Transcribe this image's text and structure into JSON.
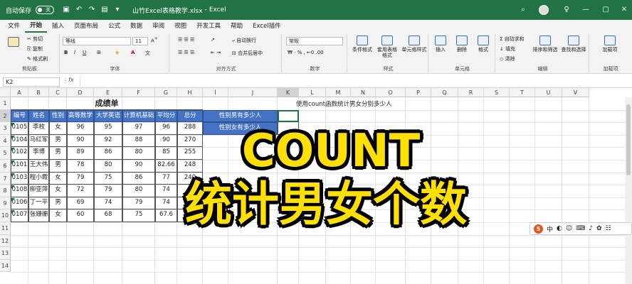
{
  "titlebar": {
    "autosave_label": "自动保存",
    "autosave_state": "关",
    "filename": "山竹Excel表格教学.xlsx",
    "app": "Excel"
  },
  "menu": [
    "文件",
    "开始",
    "插入",
    "页面布局",
    "公式",
    "数据",
    "审阅",
    "视图",
    "开发工具",
    "帮助",
    "Excel插件"
  ],
  "menu_right": {
    "comment": "批注",
    "share": "共享"
  },
  "ribbon": {
    "clipboard": {
      "cut": "剪切",
      "copy": "复制",
      "format_painter": "格式刷",
      "label": "剪贴板"
    },
    "font": {
      "family": "等线",
      "size": "11",
      "label": "字体",
      "bold": "B",
      "italic": "I",
      "underline": "U"
    },
    "alignment": {
      "wrap": "自动换行",
      "merge": "合并后居中",
      "label": "对齐方式"
    },
    "number": {
      "format": "常规",
      "label": "数字"
    },
    "styles": {
      "conditional": "条件格式",
      "table": "套用表格格式",
      "cell": "单元格样式",
      "label": "样式"
    },
    "cells": {
      "insert": "插入",
      "delete": "删除",
      "format": "格式",
      "label": "单元格"
    },
    "editing": {
      "autosum": "自动求和",
      "fill": "填充",
      "clear": "清除",
      "sort": "排序和筛选",
      "find": "查找和选择",
      "label": "编辑"
    },
    "addins": {
      "add": "加载项",
      "label": "加载项"
    }
  },
  "formula": {
    "namebox": "K2",
    "fx": "fx"
  },
  "columns": [
    "A",
    "B",
    "C",
    "D",
    "E",
    "F",
    "G",
    "H",
    "I",
    "J",
    "K",
    "L",
    "M",
    "N",
    "O",
    "P",
    "Q",
    "R",
    "S",
    "T",
    "U",
    "V"
  ],
  "rows": [
    "1",
    "2",
    "3",
    "4",
    "5",
    "6",
    "7",
    "8",
    "9",
    "10",
    "11",
    "12",
    "13",
    "14"
  ],
  "table": {
    "title": "成绩单",
    "headers": [
      "编号",
      "姓名",
      "性别",
      "高等数学",
      "大学英语",
      "计算机基础",
      "平均分",
      "总分"
    ],
    "rows": [
      [
        "0105",
        "李枚",
        "女",
        "96",
        "95",
        "97",
        "96",
        "288"
      ],
      [
        "0104",
        "马红军",
        "男",
        "90",
        "92",
        "88",
        "90",
        "270"
      ],
      [
        "0102",
        "李博",
        "男",
        "89",
        "86",
        "80",
        "85",
        "255"
      ],
      [
        "0101",
        "王大伟",
        "男",
        "78",
        "80",
        "90",
        "82.66",
        "248"
      ],
      [
        "0103",
        "程小霞",
        "女",
        "79",
        "75",
        "86",
        "77",
        "240"
      ],
      [
        "0108",
        "柳亚萍",
        "女",
        "72",
        "79",
        "80",
        "74",
        ""
      ],
      [
        "0106",
        "丁一平",
        "男",
        "69",
        "74",
        "79",
        "74",
        ""
      ],
      [
        "0107",
        "张姗姗",
        "女",
        "60",
        "68",
        "75",
        "67.6",
        ""
      ]
    ]
  },
  "side": {
    "note": "使用count函数统计男女分别多少人",
    "label1": "性别男有多少人",
    "label2": "性别女有多少人"
  },
  "overlay": {
    "line1": "COUNT",
    "line2": "统计男女个数"
  },
  "ime": {
    "logo": "S",
    "lang": "中"
  },
  "colors": {
    "excel_green": "#217346",
    "header_blue": "#4472c4",
    "overlay_yellow": "#ffe000"
  }
}
